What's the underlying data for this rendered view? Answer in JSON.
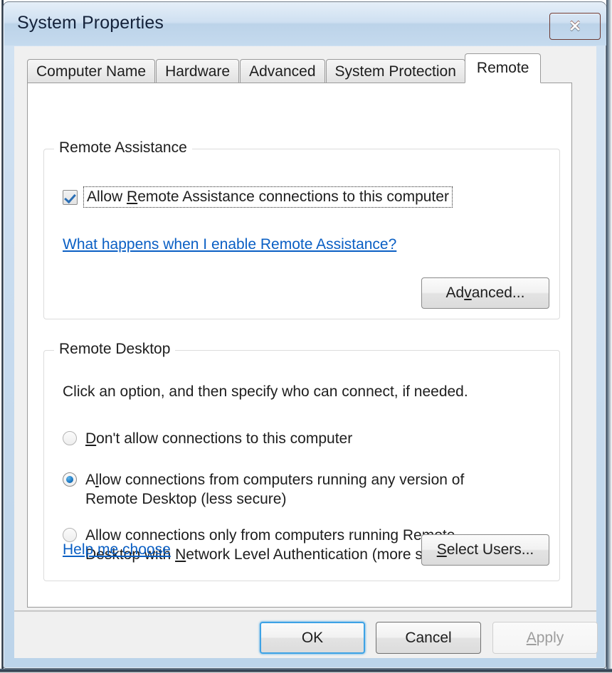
{
  "window": {
    "title": "System Properties",
    "close_icon": "close-icon",
    "close_glyph": "✕"
  },
  "tabs": [
    {
      "label": "Computer Name",
      "active": false
    },
    {
      "label": "Hardware",
      "active": false
    },
    {
      "label": "Advanced",
      "active": false
    },
    {
      "label": "System Protection",
      "active": false
    },
    {
      "label": "Remote",
      "active": true
    }
  ],
  "remote_assistance": {
    "group_label": "Remote Assistance",
    "checkbox": {
      "label_before": "Allow ",
      "accel": "R",
      "label_after": "emote Assistance connections to this computer",
      "full_label": "Allow Remote Assistance connections to this computer",
      "checked": true,
      "focused": true
    },
    "link": "What happens when I enable Remote Assistance?",
    "advanced_button": {
      "before": "Ad",
      "accel": "v",
      "after": "anced..."
    }
  },
  "remote_desktop": {
    "group_label": "Remote Desktop",
    "description": "Click an option, and then specify who can connect, if needed.",
    "options": [
      {
        "before": "",
        "accel": "D",
        "after": "on't allow connections to this computer",
        "full_label": "Don't allow connections to this computer",
        "selected": false
      },
      {
        "before": "A",
        "accel": "l",
        "after": "low connections from computers running any version of Remote Desktop (less secure)",
        "full_label": "Allow connections from computers running any version of Remote Desktop (less secure)",
        "selected": true
      },
      {
        "before": "Allow connections only from computers running Remote Desktop with ",
        "accel": "N",
        "after": "etwork Level Authentication (more secure)",
        "full_label": "Allow connections only from computers running Remote Desktop with Network Level Authentication (more secure)",
        "selected": false
      }
    ],
    "help_link": "Help me choose",
    "select_users_button": {
      "before": "",
      "accel": "S",
      "after": "elect Users..."
    }
  },
  "footer": {
    "ok_label": "OK",
    "cancel_label": "Cancel",
    "apply": {
      "before": "",
      "accel": "A",
      "after": "pply"
    },
    "apply_enabled": false
  },
  "colors": {
    "link": "#0a5fc4",
    "accent_focus": "#3da2e5",
    "radio_selected": "#1b78c4",
    "checkbox_check": "#2b6fb5",
    "close_button": "#cf5a41",
    "titlebar_top": "#e4eef8",
    "titlebar_bottom": "#c5daee",
    "frame": "#bcd4ea",
    "dialog_bg": "#f0f0f0",
    "page_bg": "#ffffff"
  }
}
